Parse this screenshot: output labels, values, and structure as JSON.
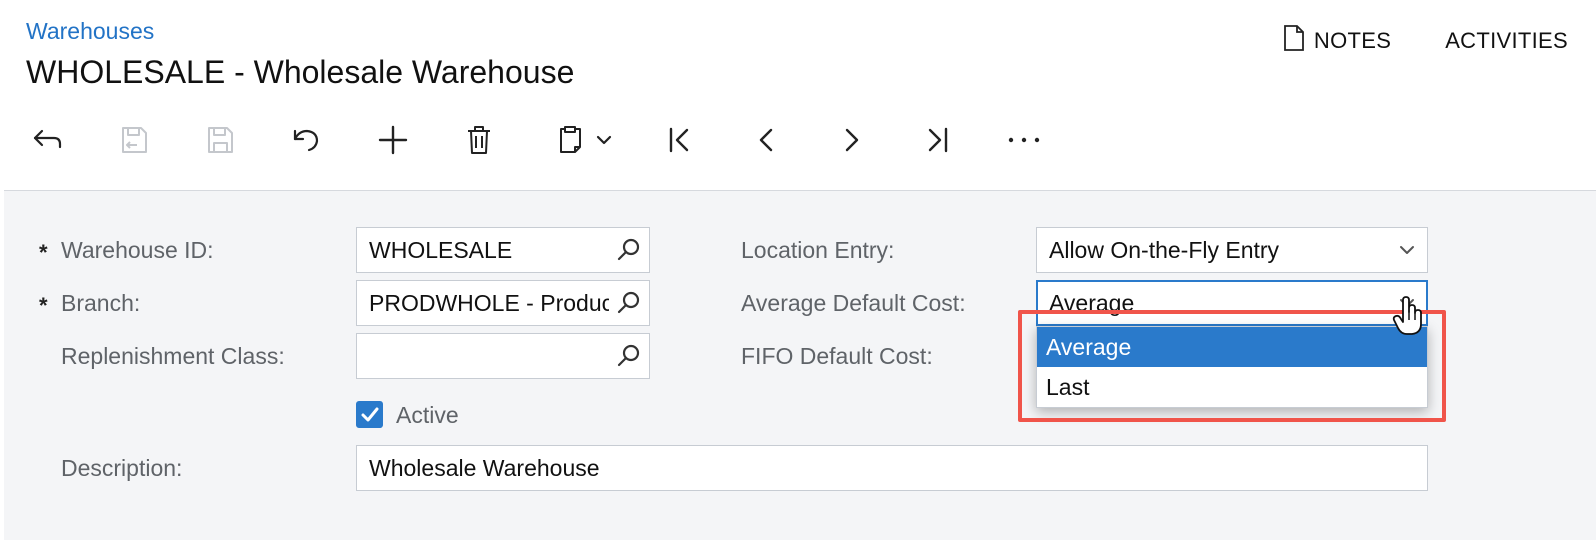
{
  "header": {
    "breadcrumb": "Warehouses",
    "title": "WHOLESALE - Wholesale Warehouse",
    "notes_label": "NOTES",
    "activities_label": "ACTIVITIES"
  },
  "toolbar": {
    "buttons": [
      {
        "name": "back",
        "icon": "back-arrow-icon",
        "enabled": true
      },
      {
        "name": "save-close",
        "icon": "save-close-icon",
        "enabled": false
      },
      {
        "name": "save",
        "icon": "save-icon",
        "enabled": false
      },
      {
        "name": "cancel",
        "icon": "undo-icon",
        "enabled": true
      },
      {
        "name": "add",
        "icon": "plus-icon",
        "enabled": true
      },
      {
        "name": "delete",
        "icon": "trash-icon",
        "enabled": true
      },
      {
        "name": "copy-paste",
        "icon": "clipboard-icon",
        "enabled": true
      },
      {
        "name": "first",
        "icon": "first-record-icon",
        "enabled": true
      },
      {
        "name": "previous",
        "icon": "chevron-left-icon",
        "enabled": true
      },
      {
        "name": "next",
        "icon": "chevron-right-icon",
        "enabled": true
      },
      {
        "name": "last",
        "icon": "last-record-icon",
        "enabled": true
      },
      {
        "name": "more",
        "icon": "more-icon",
        "enabled": true
      }
    ]
  },
  "form": {
    "required_marker": "*",
    "warehouse_id": {
      "label": "Warehouse ID:",
      "value": "WHOLESALE"
    },
    "branch": {
      "label": "Branch:",
      "value": "PRODWHOLE - Products Wholesale"
    },
    "replenishment_class": {
      "label": "Replenishment Class:",
      "value": ""
    },
    "active": {
      "label": "Active",
      "checked": true
    },
    "description": {
      "label": "Description:",
      "value": "Wholesale Warehouse"
    },
    "location_entry": {
      "label": "Location Entry:",
      "value": "Allow On-the-Fly Entry"
    },
    "average_default_cost": {
      "label": "Average Default Cost:",
      "value": "Average",
      "options": [
        "Average",
        "Last"
      ],
      "selected": "Average"
    },
    "fifo_default_cost": {
      "label": "FIFO Default Cost:"
    }
  },
  "colors": {
    "link": "#2273c6",
    "accent": "#2a7acb",
    "highlight": "#f0544a",
    "content_bg": "#f4f5f7"
  }
}
